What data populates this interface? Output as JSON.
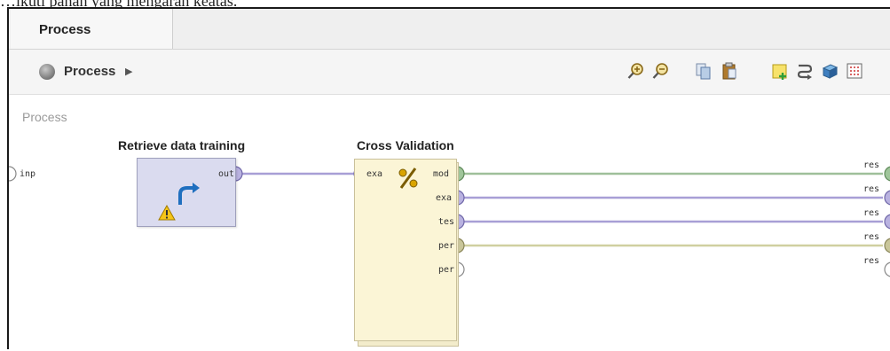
{
  "caption": "…ikuti panah yang mengarah keatas.",
  "tab": {
    "label": "Process"
  },
  "breadcrumb": {
    "label": "Process"
  },
  "toolbar": {
    "icons": [
      "zoom-in-icon",
      "zoom-out-icon",
      "copy-icon",
      "paste-icon",
      "add-note-icon",
      "auto-wire-icon",
      "3d-cube-icon",
      "grid-icon"
    ]
  },
  "canvas": {
    "title": "Process",
    "input_port": "inp",
    "operators": {
      "retrieve": {
        "title": "Retrieve data training",
        "out_port": "out",
        "status": "warning"
      },
      "cross_validation": {
        "title": "Cross Validation",
        "in_port": "exa",
        "out_ports": [
          "mod",
          "exa",
          "tes",
          "per",
          "per"
        ]
      }
    },
    "result_ports": [
      "res",
      "res",
      "res",
      "res",
      "res"
    ]
  },
  "colors": {
    "wire_purple": "#a89fd6",
    "wire_green": "#9fbf9a",
    "wire_olive": "#cfcfa0",
    "operator_fill": "#dadbef",
    "cv_fill": "#fbf5d6"
  }
}
